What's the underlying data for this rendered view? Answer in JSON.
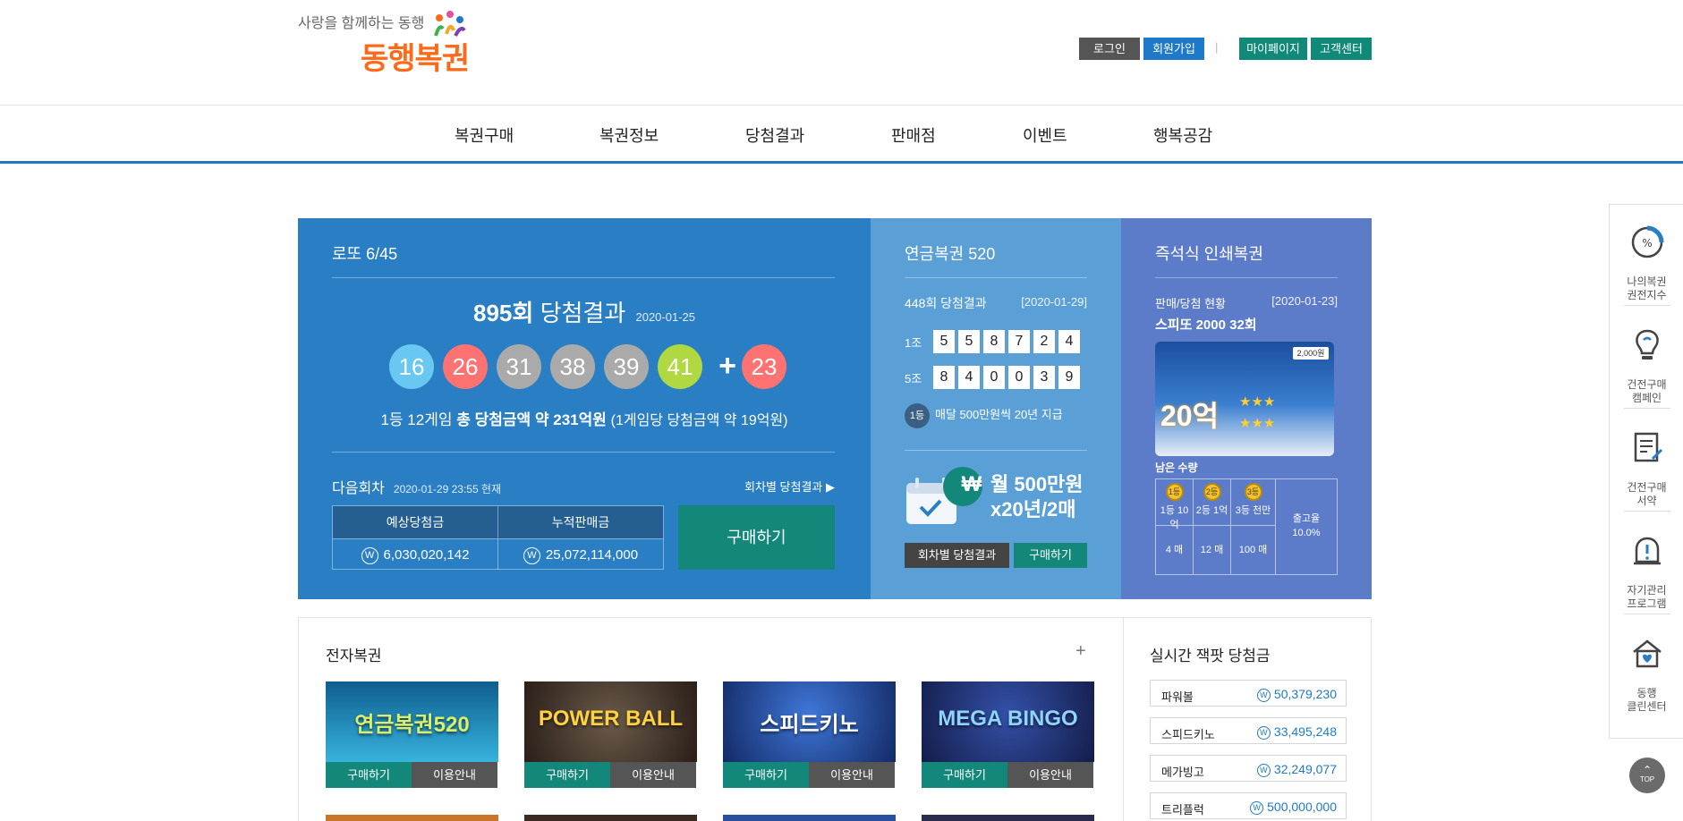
{
  "header": {
    "tagline": "사랑을 함께하는 동행",
    "logo_text": "동행복권",
    "login": "로그인",
    "join": "회원가입",
    "separator": "|",
    "mypage": "마이페이지",
    "cs": "고객센터"
  },
  "nav": [
    "복권구매",
    "복권정보",
    "당첨결과",
    "판매점",
    "이벤트",
    "행복공감"
  ],
  "lotto": {
    "title": "로또 6/45",
    "round": "895회",
    "result_label": "당첨결과",
    "date": "2020-01-25",
    "numbers": [
      {
        "n": "16",
        "color": "#69c8f2"
      },
      {
        "n": "26",
        "color": "#ff7272"
      },
      {
        "n": "31",
        "color": "#aaaaaa"
      },
      {
        "n": "38",
        "color": "#aaaaaa"
      },
      {
        "n": "39",
        "color": "#aaaaaa"
      },
      {
        "n": "41",
        "color": "#b0d840"
      }
    ],
    "plus": "+",
    "bonus": {
      "n": "23",
      "color": "#ff7272"
    },
    "prize_prefix": "1등 12게임",
    "prize_total": "총 당첨금액 약 231억원",
    "prize_each": "(1게임당 당첨금액 약 19억원)",
    "next_label": "다음회차",
    "next_date": "2020-01-29 23:55 현재",
    "round_results_link": "회차별 당첨결과 ▶",
    "est_header": "예상당첨금",
    "acc_header": "누적판매금",
    "est_value": "6,030,020,142",
    "acc_value": "25,072,114,000",
    "won_symbol": "W",
    "buy": "구매하기"
  },
  "pension": {
    "title": "연금복권 520",
    "round": "448회 당첨결과",
    "date": "[2020-01-29]",
    "row1_label": "1조",
    "row1_digits": [
      "5",
      "5",
      "8",
      "7",
      "2",
      "4"
    ],
    "row2_label": "5조",
    "row2_digits": [
      "8",
      "4",
      "0",
      "0",
      "3",
      "9"
    ],
    "rank_badge": "1등",
    "info": "매달 500만원씩 20년 지급",
    "promo_line1": "월 500만원",
    "promo_line2": "x20년/2매",
    "won_symbol": "₩",
    "results_btn": "회차별 당첨결과",
    "buy_btn": "구매하기"
  },
  "instant": {
    "title": "즉석식 인쇄복권",
    "status_label": "판매/당첨 현황",
    "date": "[2020-01-23]",
    "game": "스피또 2000 32회",
    "card_big": "20억",
    "card_tag": "2,000원",
    "remaining_label": "남은 수량",
    "cols": [
      {
        "rank": "1등",
        "prize": "1등 10억",
        "count": "4 매"
      },
      {
        "rank": "2등",
        "prize": "2등 1억",
        "count": "12 매"
      },
      {
        "rank": "3등",
        "prize": "3등 천만",
        "count": "100 매"
      }
    ],
    "release_label": "출고율",
    "release_value": "10.0%"
  },
  "electronic": {
    "title": "전자복권",
    "more": "+",
    "games": [
      {
        "name": "연금복권520",
        "bg": "#1b8fbf",
        "buy": "구매하기",
        "info": "이용안내"
      },
      {
        "name": "POWER BALL",
        "bg": "#3a2a20",
        "buy": "구매하기",
        "info": "이용안내"
      },
      {
        "name": "스피드키노",
        "bg": "#1c3f8f",
        "buy": "구매하기",
        "info": "이용안내"
      },
      {
        "name": "MEGA BINGO",
        "bg": "#1a2d66",
        "buy": "구매하기",
        "info": "이용안내"
      }
    ]
  },
  "jackpot": {
    "title": "실시간 잭팟 당첨금",
    "items": [
      {
        "name": "파워볼",
        "value": "50,379,230"
      },
      {
        "name": "스피드키노",
        "value": "33,495,248"
      },
      {
        "name": "메가빙고",
        "value": "32,249,077"
      },
      {
        "name": "트리플럭",
        "value": "500,000,000"
      }
    ],
    "won_symbol": "W"
  },
  "quick_menu": {
    "items": [
      {
        "l1": "나의복권",
        "l2": "권전지수"
      },
      {
        "l1": "건전구매",
        "l2": "캠페인"
      },
      {
        "l1": "건전구매",
        "l2": "서약"
      },
      {
        "l1": "자기관리",
        "l2": "프로그램"
      },
      {
        "l1": "동행",
        "l2": "클린센터"
      }
    ],
    "top": "TOP"
  }
}
